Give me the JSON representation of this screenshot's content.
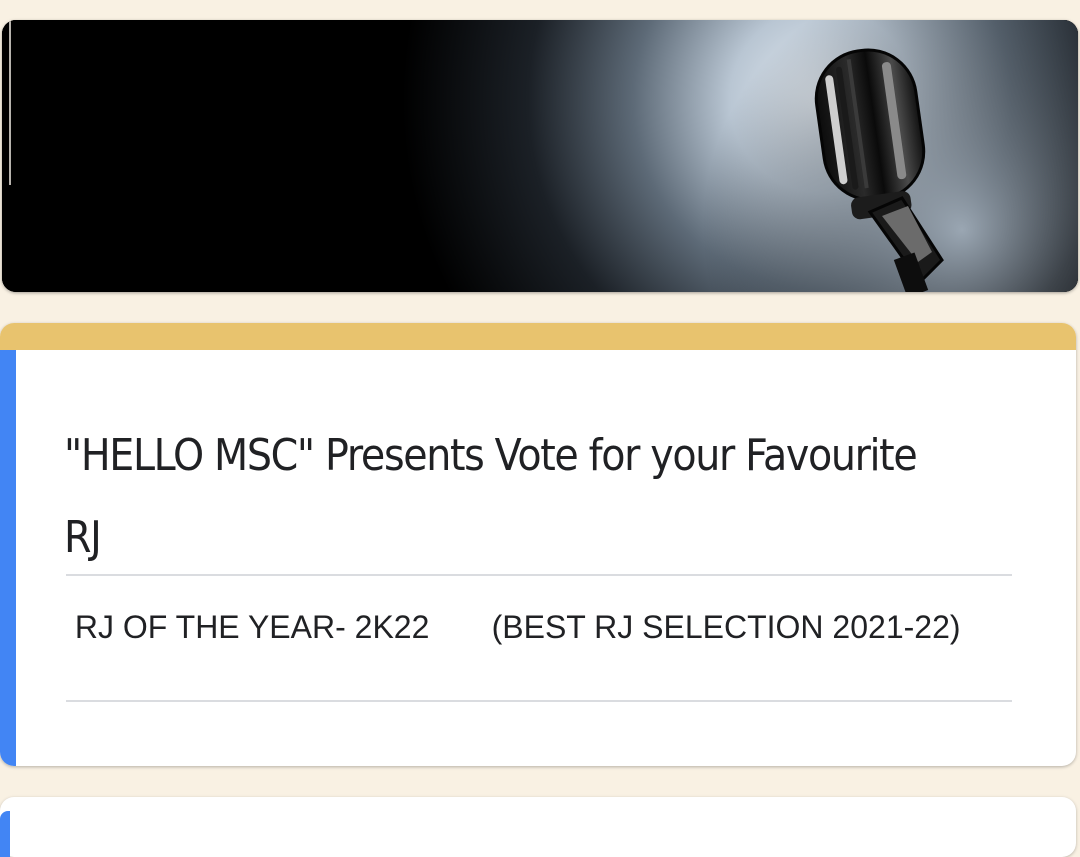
{
  "form": {
    "title": "\"HELLO MSC\" Presents Vote for your Favourite RJ",
    "description": " RJ OF THE YEAR- 2K22       (BEST RJ SELECTION 2021-22)"
  },
  "header_image": {
    "subject": "vintage microphone on stage under spotlight"
  },
  "colors": {
    "page_background": "#f9f1e3",
    "theme_accent": "#e8c36e",
    "focus_accent": "#4285f4",
    "card_background": "#ffffff",
    "divider": "#dadce0",
    "text": "#202124"
  }
}
